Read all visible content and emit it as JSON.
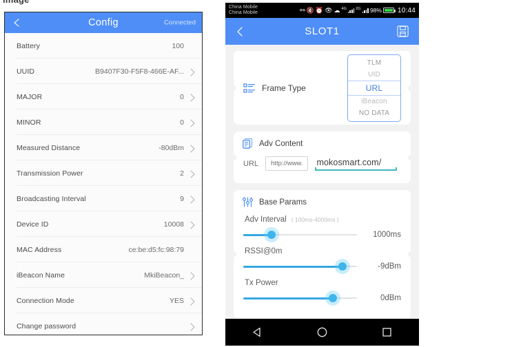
{
  "stray_caption": "image",
  "left_panel": {
    "header": {
      "back_icon": "chevron-left-icon",
      "title": "Config",
      "status": "Connected"
    },
    "rows": [
      {
        "label": "Battery",
        "value": "100",
        "chevron": false
      },
      {
        "label": "UUID",
        "value": "B9407F30-F5F8-466E-AF...",
        "chevron": true
      },
      {
        "label": "MAJOR",
        "value": "0",
        "chevron": true
      },
      {
        "label": "MINOR",
        "value": "0",
        "chevron": true
      },
      {
        "label": "Measured Distance",
        "value": "-80dBm",
        "chevron": true
      },
      {
        "label": "Transmission Power",
        "value": "2",
        "chevron": true
      },
      {
        "label": "Broadcasting Interval",
        "value": "9",
        "chevron": true
      },
      {
        "label": "Device ID",
        "value": "10008",
        "chevron": true
      },
      {
        "label": "MAC Address",
        "value": "ce:be:d5:fc:98:79",
        "chevron": false
      },
      {
        "label": "iBeacon Name",
        "value": "MkiBeacon_",
        "chevron": true
      },
      {
        "label": "Connection Mode",
        "value": "YES",
        "chevron": true
      },
      {
        "label": "Change password",
        "value": "",
        "chevron": true
      }
    ]
  },
  "right_panel": {
    "status_bar": {
      "carrier_line1": "China Mobile",
      "carrier_line2": "China Mobile",
      "bluetooth_icon": "bluetooth-icon",
      "mute_icon": "mute-icon",
      "alarm_icon": "alarm-icon",
      "eye_icon": "eye-icon",
      "wifi_icon": "wifi-icon",
      "signal1_label": "4G",
      "signal2_label": "2G",
      "battery_percent": "98%",
      "battery_icon": "battery-icon",
      "clock": "10:44"
    },
    "app_bar": {
      "back_icon": "chevron-left-icon",
      "title": "SLOT1",
      "save_icon": "save-floppy-icon"
    },
    "frame_type": {
      "icon": "list-icon",
      "title": "Frame Type",
      "options": [
        "TLM",
        "UID",
        "URL",
        "iBeacon",
        "NO DATA"
      ],
      "selected": "URL",
      "accent_color": "#3f7fe0"
    },
    "adv_content": {
      "icon": "document-icon",
      "title": "Adv Content",
      "url_label": "URL",
      "url_prefix": "http://www.",
      "url_value": "mokosmart.com/",
      "underline_color": "#3fb8c4"
    },
    "base_params": {
      "icon": "sliders-icon",
      "title": "Base Params",
      "params": [
        {
          "label": "Adv Interval",
          "hint": "( 100ms-4000ms )",
          "value": "1000ms",
          "percent": 25
        },
        {
          "label": "RSSI@0m",
          "hint": "",
          "value": "-9dBm",
          "percent": 87
        },
        {
          "label": "Tx Power",
          "hint": "",
          "value": "0dBm",
          "percent": 79
        }
      ],
      "slider_color": "#35a8e0"
    },
    "nav_bar": {
      "back_icon": "triangle-back-icon",
      "home_icon": "circle-home-icon",
      "recents_icon": "square-recents-icon"
    }
  }
}
